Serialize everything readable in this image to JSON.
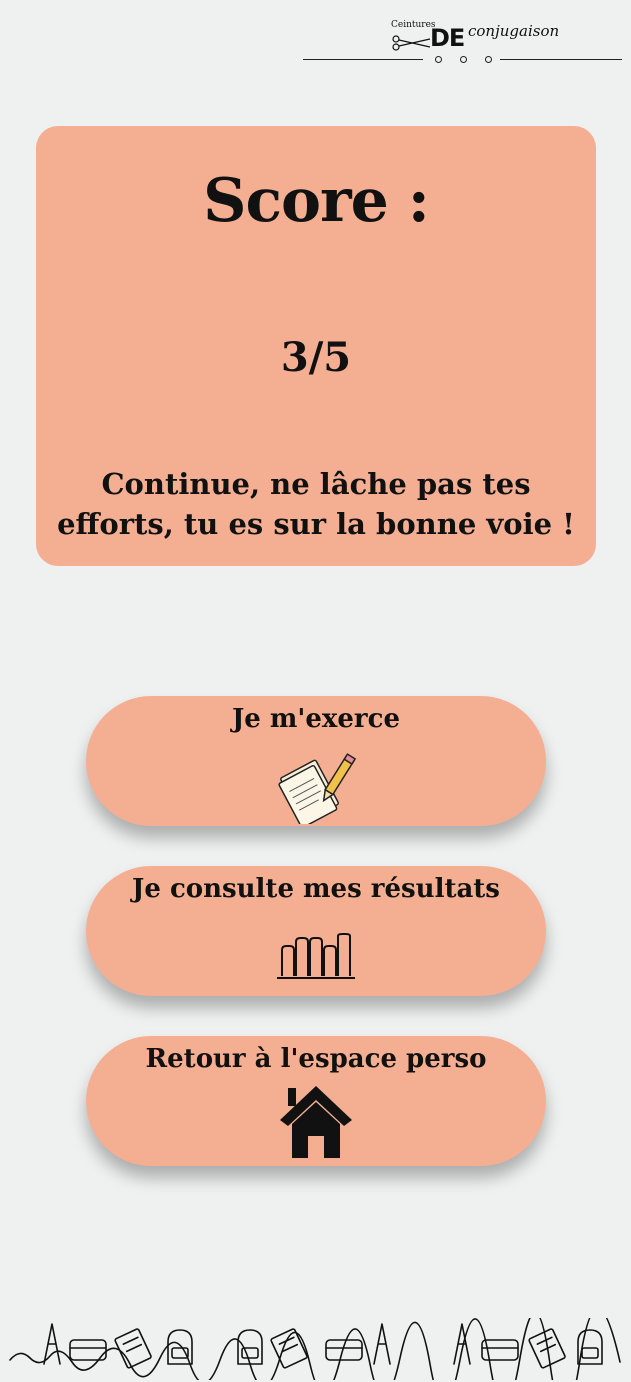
{
  "logo": {
    "small_text": "Ceintures",
    "brand_text": "DE",
    "script_text": "conjugaison"
  },
  "score": {
    "title": "Score :",
    "value": "3/5",
    "message": "Continue, ne lâche pas tes efforts, tu es sur la bonne voie !"
  },
  "actions": [
    {
      "label": "Je m'exerce",
      "icon": "notebook-pencil-icon"
    },
    {
      "label": "Je consulte mes résultats",
      "icon": "bar-chart-icon"
    },
    {
      "label": "Retour à l'espace perso",
      "icon": "home-icon"
    }
  ],
  "colors": {
    "background": "#eff1f1",
    "card": "#f4af93",
    "text": "#111111"
  }
}
